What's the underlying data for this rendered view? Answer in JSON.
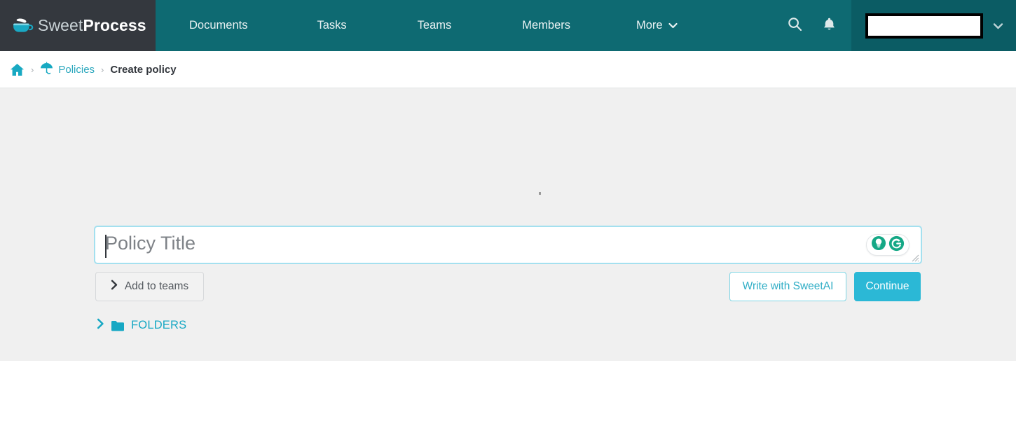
{
  "brand": {
    "icon": "coffee-cup-icon",
    "name_light": "Sweet",
    "name_bold": "Process"
  },
  "nav": {
    "items": [
      {
        "label": "Documents",
        "icon": null
      },
      {
        "label": "Tasks",
        "icon": null
      },
      {
        "label": "Teams",
        "icon": null
      },
      {
        "label": "Members",
        "icon": null
      },
      {
        "label": "More",
        "icon": "chevron-down-icon"
      }
    ],
    "search_icon": "search-icon",
    "notifications_icon": "bell-icon",
    "user_name": "",
    "user_caret_icon": "chevron-down-icon"
  },
  "breadcrumb": {
    "home_icon": "home-icon",
    "separator": "›",
    "policies_icon": "umbrella-icon",
    "policies_label": "Policies",
    "current_label": "Create policy"
  },
  "main": {
    "stray_dot": "",
    "title_field": {
      "value": "",
      "placeholder": "Policy Title",
      "assistant_icons": [
        "lightbulb-icon",
        "grammarly-g-icon"
      ],
      "resize_handle": "resize-grip-icon"
    },
    "buttons": {
      "add_to_teams": {
        "label": "Add to teams",
        "icon": "chevron-right-icon"
      },
      "write_with_sweetai": {
        "label": "Write with SweetAI"
      },
      "continue": {
        "label": "Continue"
      }
    },
    "folders": {
      "toggle_icon": "chevron-right-icon",
      "folder_icon": "folder-icon",
      "label": "FOLDERS"
    }
  },
  "colors": {
    "nav_teal": "#0e6a72",
    "nav_teal_dark": "#0b5c64",
    "brand_dark": "#34383e",
    "accent_teal": "#2aa7bd",
    "accent_cyan": "#2bb8d6",
    "panel_bg": "#f0f0f0",
    "grammarly_green": "#15a886"
  }
}
